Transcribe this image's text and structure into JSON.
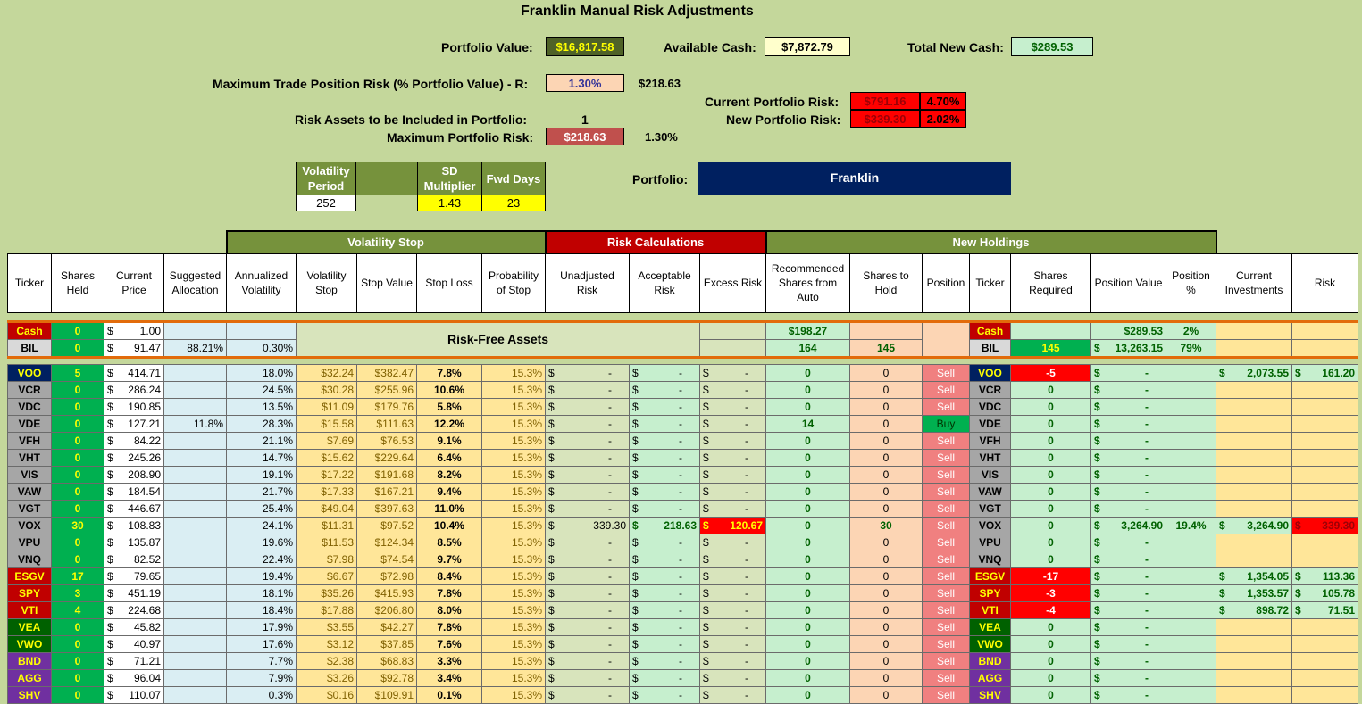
{
  "title": "Franklin Manual Risk Adjustments",
  "summary": {
    "portfolio_value_label": "Portfolio Value:",
    "portfolio_value": "$16,817.58",
    "available_cash_label": "Available Cash:",
    "available_cash": "$7,872.79",
    "total_new_cash_label": "Total New Cash:",
    "total_new_cash": "$289.53",
    "max_trade_risk_label": "Maximum Trade Position Risk (% Portfolio Value) - R:",
    "max_trade_risk_pct": "1.30%",
    "max_trade_risk_amt": "$218.63",
    "current_risk_label": "Current Portfolio Risk:",
    "current_risk_amt": "$791.16",
    "current_risk_pct": "4.70%",
    "new_risk_label": "New Portfolio Risk:",
    "new_risk_amt": "$339.30",
    "new_risk_pct": "2.02%",
    "risk_assets_label": "Risk Assets to be Included in Portfolio:",
    "risk_assets": "1",
    "max_portfolio_risk_label": "Maximum Portfolio Risk:",
    "max_portfolio_risk_amt": "$218.63",
    "max_portfolio_risk_pct": "1.30%"
  },
  "volatility": {
    "period_label": "Volatility Period",
    "sd_label": "SD Multiplier",
    "fwd_label": "Fwd Days",
    "period": "252",
    "sd": "1.43",
    "fwd": "23"
  },
  "portfolio": {
    "label": "Portfolio:",
    "name": "Franklin"
  },
  "groups": {
    "vol_stop": "Volatility Stop",
    "risk_calc": "Risk Calculations",
    "new_holdings": "New Holdings"
  },
  "headers": [
    "Ticker",
    "Shares Held",
    "Current Price",
    "Suggested Allocation",
    "Annualized Volatility",
    "Volatility Stop",
    "Stop Value",
    "Stop Loss",
    "Probability of Stop",
    "Unadjusted Risk",
    "Acceptable Risk",
    "Excess Risk",
    "Recommended Shares from Auto",
    "Shares to Hold",
    "Position",
    "Ticker",
    "Shares Required",
    "Position Value",
    "Position %",
    "Current Investments",
    "Risk"
  ],
  "risk_free_label": "Risk-Free Assets",
  "cash_row": {
    "ticker": "Cash",
    "shares": "0",
    "price": "1.00",
    "rec": "$198.27",
    "ticker2": "Cash",
    "posval": "$289.53",
    "pospct": "2%"
  },
  "bil_row": {
    "ticker": "BIL",
    "shares": "0",
    "price": "91.47",
    "alloc": "88.21%",
    "vol": "0.30%",
    "rec": "164",
    "hold": "145",
    "ticker2": "BIL",
    "req": "145",
    "posval": "13,263.15",
    "pospct": "79%"
  },
  "dollar": "$",
  "dash": "-",
  "rows": [
    {
      "t": "VOO",
      "sh": "5",
      "p": "414.71",
      "al": "",
      "v": "18.0%",
      "vs": "$32.24",
      "sv": "$382.47",
      "sl": "7.8%",
      "pr": "15.3%",
      "ur": "-",
      "ar": "-",
      "er": "-",
      "rec": "0",
      "hold": "0",
      "pos": "Sell",
      "req": "-5",
      "pv": "-",
      "pp": "",
      "ci": "2,073.55",
      "rk": "161.20"
    },
    {
      "t": "VCR",
      "sh": "0",
      "p": "286.24",
      "al": "",
      "v": "24.5%",
      "vs": "$30.28",
      "sv": "$255.96",
      "sl": "10.6%",
      "pr": "15.3%",
      "ur": "-",
      "ar": "-",
      "er": "-",
      "rec": "0",
      "hold": "0",
      "pos": "Sell",
      "req": "0",
      "pv": "-",
      "pp": "",
      "ci": "",
      "rk": ""
    },
    {
      "t": "VDC",
      "sh": "0",
      "p": "190.85",
      "al": "",
      "v": "13.5%",
      "vs": "$11.09",
      "sv": "$179.76",
      "sl": "5.8%",
      "pr": "15.3%",
      "ur": "-",
      "ar": "-",
      "er": "-",
      "rec": "0",
      "hold": "0",
      "pos": "Sell",
      "req": "0",
      "pv": "-",
      "pp": "",
      "ci": "",
      "rk": ""
    },
    {
      "t": "VDE",
      "sh": "0",
      "p": "127.21",
      "al": "11.8%",
      "v": "28.3%",
      "vs": "$15.58",
      "sv": "$111.63",
      "sl": "12.2%",
      "pr": "15.3%",
      "ur": "-",
      "ar": "-",
      "er": "-",
      "rec": "14",
      "hold": "0",
      "pos": "Buy",
      "req": "0",
      "pv": "-",
      "pp": "",
      "ci": "",
      "rk": ""
    },
    {
      "t": "VFH",
      "sh": "0",
      "p": "84.22",
      "al": "",
      "v": "21.1%",
      "vs": "$7.69",
      "sv": "$76.53",
      "sl": "9.1%",
      "pr": "15.3%",
      "ur": "-",
      "ar": "-",
      "er": "-",
      "rec": "0",
      "hold": "0",
      "pos": "Sell",
      "req": "0",
      "pv": "-",
      "pp": "",
      "ci": "",
      "rk": ""
    },
    {
      "t": "VHT",
      "sh": "0",
      "p": "245.26",
      "al": "",
      "v": "14.7%",
      "vs": "$15.62",
      "sv": "$229.64",
      "sl": "6.4%",
      "pr": "15.3%",
      "ur": "-",
      "ar": "-",
      "er": "-",
      "rec": "0",
      "hold": "0",
      "pos": "Sell",
      "req": "0",
      "pv": "-",
      "pp": "",
      "ci": "",
      "rk": ""
    },
    {
      "t": "VIS",
      "sh": "0",
      "p": "208.90",
      "al": "",
      "v": "19.1%",
      "vs": "$17.22",
      "sv": "$191.68",
      "sl": "8.2%",
      "pr": "15.3%",
      "ur": "-",
      "ar": "-",
      "er": "-",
      "rec": "0",
      "hold": "0",
      "pos": "Sell",
      "req": "0",
      "pv": "-",
      "pp": "",
      "ci": "",
      "rk": ""
    },
    {
      "t": "VAW",
      "sh": "0",
      "p": "184.54",
      "al": "",
      "v": "21.7%",
      "vs": "$17.33",
      "sv": "$167.21",
      "sl": "9.4%",
      "pr": "15.3%",
      "ur": "-",
      "ar": "-",
      "er": "-",
      "rec": "0",
      "hold": "0",
      "pos": "Sell",
      "req": "0",
      "pv": "-",
      "pp": "",
      "ci": "",
      "rk": ""
    },
    {
      "t": "VGT",
      "sh": "0",
      "p": "446.67",
      "al": "",
      "v": "25.4%",
      "vs": "$49.04",
      "sv": "$397.63",
      "sl": "11.0%",
      "pr": "15.3%",
      "ur": "-",
      "ar": "-",
      "er": "-",
      "rec": "0",
      "hold": "0",
      "pos": "Sell",
      "req": "0",
      "pv": "-",
      "pp": "",
      "ci": "",
      "rk": ""
    },
    {
      "t": "VOX",
      "sh": "30",
      "p": "108.83",
      "al": "",
      "v": "24.1%",
      "vs": "$11.31",
      "sv": "$97.52",
      "sl": "10.4%",
      "pr": "15.3%",
      "ur": "339.30",
      "ar": "218.63",
      "er": "120.67",
      "rec": "0",
      "hold": "30",
      "pos": "Sell",
      "req": "0",
      "pv": "3,264.90",
      "pp": "19.4%",
      "ci": "3,264.90",
      "rk": "339.30"
    },
    {
      "t": "VPU",
      "sh": "0",
      "p": "135.87",
      "al": "",
      "v": "19.6%",
      "vs": "$11.53",
      "sv": "$124.34",
      "sl": "8.5%",
      "pr": "15.3%",
      "ur": "-",
      "ar": "-",
      "er": "-",
      "rec": "0",
      "hold": "0",
      "pos": "Sell",
      "req": "0",
      "pv": "-",
      "pp": "",
      "ci": "",
      "rk": ""
    },
    {
      "t": "VNQ",
      "sh": "0",
      "p": "82.52",
      "al": "",
      "v": "22.4%",
      "vs": "$7.98",
      "sv": "$74.54",
      "sl": "9.7%",
      "pr": "15.3%",
      "ur": "-",
      "ar": "-",
      "er": "-",
      "rec": "0",
      "hold": "0",
      "pos": "Sell",
      "req": "0",
      "pv": "-",
      "pp": "",
      "ci": "",
      "rk": ""
    },
    {
      "t": "ESGV",
      "sh": "17",
      "p": "79.65",
      "al": "",
      "v": "19.4%",
      "vs": "$6.67",
      "sv": "$72.98",
      "sl": "8.4%",
      "pr": "15.3%",
      "ur": "-",
      "ar": "-",
      "er": "-",
      "rec": "0",
      "hold": "0",
      "pos": "Sell",
      "req": "-17",
      "pv": "-",
      "pp": "",
      "ci": "1,354.05",
      "rk": "113.36"
    },
    {
      "t": "SPY",
      "sh": "3",
      "p": "451.19",
      "al": "",
      "v": "18.1%",
      "vs": "$35.26",
      "sv": "$415.93",
      "sl": "7.8%",
      "pr": "15.3%",
      "ur": "-",
      "ar": "-",
      "er": "-",
      "rec": "0",
      "hold": "0",
      "pos": "Sell",
      "req": "-3",
      "pv": "-",
      "pp": "",
      "ci": "1,353.57",
      "rk": "105.78"
    },
    {
      "t": "VTI",
      "sh": "4",
      "p": "224.68",
      "al": "",
      "v": "18.4%",
      "vs": "$17.88",
      "sv": "$206.80",
      "sl": "8.0%",
      "pr": "15.3%",
      "ur": "-",
      "ar": "-",
      "er": "-",
      "rec": "0",
      "hold": "0",
      "pos": "Sell",
      "req": "-4",
      "pv": "-",
      "pp": "",
      "ci": "898.72",
      "rk": "71.51"
    },
    {
      "t": "VEA",
      "sh": "0",
      "p": "45.82",
      "al": "",
      "v": "17.9%",
      "vs": "$3.55",
      "sv": "$42.27",
      "sl": "7.8%",
      "pr": "15.3%",
      "ur": "-",
      "ar": "-",
      "er": "-",
      "rec": "0",
      "hold": "0",
      "pos": "Sell",
      "req": "0",
      "pv": "-",
      "pp": "",
      "ci": "",
      "rk": ""
    },
    {
      "t": "VWO",
      "sh": "0",
      "p": "40.97",
      "al": "",
      "v": "17.6%",
      "vs": "$3.12",
      "sv": "$37.85",
      "sl": "7.6%",
      "pr": "15.3%",
      "ur": "-",
      "ar": "-",
      "er": "-",
      "rec": "0",
      "hold": "0",
      "pos": "Sell",
      "req": "0",
      "pv": "-",
      "pp": "",
      "ci": "",
      "rk": ""
    },
    {
      "t": "BND",
      "sh": "0",
      "p": "71.21",
      "al": "",
      "v": "7.7%",
      "vs": "$2.38",
      "sv": "$68.83",
      "sl": "3.3%",
      "pr": "15.3%",
      "ur": "-",
      "ar": "-",
      "er": "-",
      "rec": "0",
      "hold": "0",
      "pos": "Sell",
      "req": "0",
      "pv": "-",
      "pp": "",
      "ci": "",
      "rk": ""
    },
    {
      "t": "AGG",
      "sh": "0",
      "p": "96.04",
      "al": "",
      "v": "7.9%",
      "vs": "$3.26",
      "sv": "$92.78",
      "sl": "3.4%",
      "pr": "15.3%",
      "ur": "-",
      "ar": "-",
      "er": "-",
      "rec": "0",
      "hold": "0",
      "pos": "Sell",
      "req": "0",
      "pv": "-",
      "pp": "",
      "ci": "",
      "rk": ""
    },
    {
      "t": "SHV",
      "sh": "0",
      "p": "110.07",
      "al": "",
      "v": "0.3%",
      "vs": "$0.16",
      "sv": "$109.91",
      "sl": "0.1%",
      "pr": "15.3%",
      "ur": "-",
      "ar": "-",
      "er": "-",
      "rec": "0",
      "hold": "0",
      "pos": "Sell",
      "req": "0",
      "pv": "-",
      "pp": "",
      "ci": "",
      "rk": ""
    }
  ],
  "colors": {
    "bg": "#c4d79b",
    "olive": "#76923c",
    "red": "#c00000",
    "green_cell": "#00b050",
    "light_blue": "#daeef3",
    "light_orange": "#ffe699",
    "light_green": "#c6efce",
    "peach": "#fcd5b4",
    "sell": "#f08080",
    "buy": "#00b050",
    "navy": "#002060",
    "yellow": "#ffff00"
  }
}
